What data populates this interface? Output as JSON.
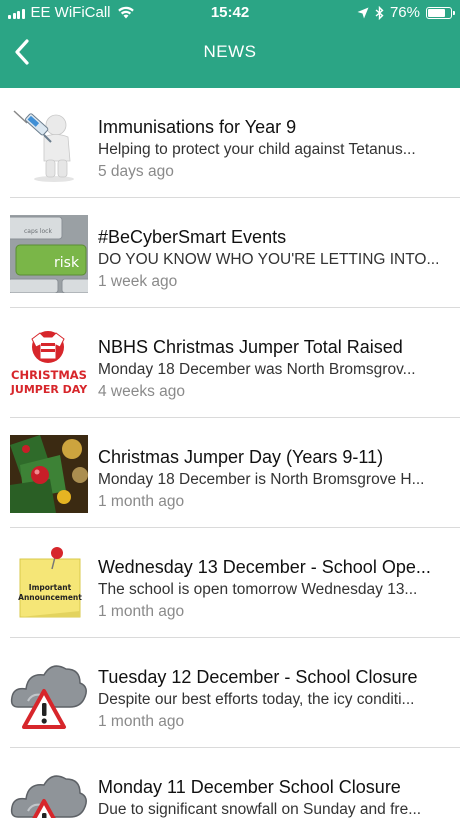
{
  "status_bar": {
    "carrier": "EE WiFiCall",
    "time": "15:42",
    "battery": "76%",
    "battery_level": 0.76
  },
  "nav": {
    "title": "NEWS",
    "back_icon": "chevron-left-icon"
  },
  "news": [
    {
      "title": "Immunisations for Year 9",
      "summary": "Helping to protect your child against Tetanus...",
      "time": "5 days ago",
      "thumb": "immunisation-thumbnail"
    },
    {
      "title": "#BeCyberSmart Events",
      "summary": "DO YOU KNOW WHO YOU'RE LETTING INTO...",
      "time": "1 week ago",
      "thumb": "cyber-risk-keyboard-thumbnail",
      "thumb_text": {
        "key_top": "caps lock",
        "key": "risk"
      }
    },
    {
      "title": "NBHS Christmas Jumper Total Raised",
      "summary": "Monday 18 December was North Bromsgrov...",
      "time": "4 weeks ago",
      "thumb": "christmas-jumper-day-logo",
      "thumb_text": {
        "line1": "CHRISTMAS",
        "line2": "JUMPER DAY"
      }
    },
    {
      "title": "Christmas Jumper Day (Years 9-11)",
      "summary": "Monday 18 December is North Bromsgrove H...",
      "time": "1 month ago",
      "thumb": "christmas-tree-thumbnail"
    },
    {
      "title": "Wednesday 13 December - School Ope...",
      "summary": "The school is open tomorrow Wednesday 13...",
      "time": "1 month ago",
      "thumb": "important-announcement-note",
      "thumb_text": {
        "line1": "Important",
        "line2": "Announcement"
      }
    },
    {
      "title": "Tuesday 12 December - School Closure",
      "summary": "Despite our best efforts today, the icy conditi...",
      "time": "1 month ago",
      "thumb": "storm-warning-icon"
    },
    {
      "title": "Monday 11 December School Closure",
      "summary": "Due to significant snowfall on Sunday and fre...",
      "time": "",
      "thumb": "storm-warning-icon"
    }
  ],
  "colors": {
    "header": "#2ba585",
    "text": "#111111",
    "muted": "#8a8a8a",
    "warning_red": "#d7262b",
    "cyber_green": "#7ab648"
  }
}
